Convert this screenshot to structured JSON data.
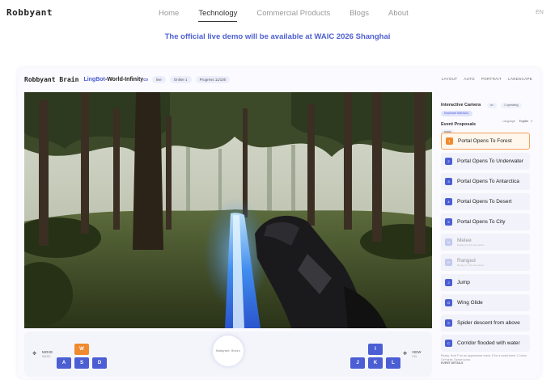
{
  "site": {
    "logo": "Robbyant",
    "nav": [
      {
        "label": "Home",
        "active": false
      },
      {
        "label": "Technology",
        "active": true
      },
      {
        "label": "Commercial Products",
        "active": false
      },
      {
        "label": "Blogs",
        "active": false
      },
      {
        "label": "About",
        "active": false
      }
    ],
    "lang": "EN",
    "banner": "The official live demo will be available at WAIC 2026 Shanghai"
  },
  "demo": {
    "brand": "Robbyant Brain",
    "model_prefix": "LingBot",
    "model_suffix": "-World-Infinity",
    "model_tag": "co",
    "pills": [
      "live",
      "Online 1",
      "Progress 11/100"
    ],
    "view_tabs": [
      "LANDSCAPE",
      "PORTRAIT",
      "AUTO",
      "LAYOUT"
    ]
  },
  "controls": {
    "move_label": "MOVE",
    "move_sub": "WASD",
    "view_label": "VIEW",
    "view_sub": "IJKL",
    "left_keys": {
      "up": "W",
      "left": "A",
      "down": "S",
      "right": "D"
    },
    "right_keys": {
      "up": "I",
      "left": "J",
      "down": "K",
      "right": "L"
    },
    "center_logo": "Robbyant Brain",
    "active_key": "W"
  },
  "side_panel": {
    "camera_title": "Interactive Camera",
    "camera_pills": [
      "on",
      "1 operating"
    ],
    "camera_mode": "Keyboard MANUAL",
    "events_title": "Event Proposals",
    "events_status": "ready",
    "language_label": "Language",
    "language_value": "English",
    "events": [
      {
        "num": "1",
        "label": "Portal Opens To Forest",
        "active": true,
        "dim": false
      },
      {
        "num": "2",
        "label": "Portal Opens To Underwater",
        "active": false,
        "dim": false
      },
      {
        "num": "3",
        "label": "Portal Opens To Antarctica",
        "active": false,
        "dim": false
      },
      {
        "num": "4",
        "label": "Portal Opens To Desert",
        "active": false,
        "dim": false
      },
      {
        "num": "5",
        "label": "Portal Opens To City",
        "active": false,
        "dim": false
      },
      {
        "num": "M",
        "label": "Melee",
        "hint": "Ready for 3rd-view action",
        "active": false,
        "dim": true
      },
      {
        "num": "R",
        "label": "Ranged",
        "hint": "Ready for 3rd-view action",
        "active": false,
        "dim": true
      },
      {
        "num": "J",
        "label": "Jump",
        "active": false,
        "dim": false
      },
      {
        "num": "G",
        "label": "Wing Glide",
        "active": false,
        "dim": false
      },
      {
        "num": "S",
        "label": "Spider descent from above",
        "active": false,
        "dim": false
      },
      {
        "num": "C",
        "label": "Corridor flooded with water",
        "active": false,
        "dim": false
      }
    ],
    "footer": "Ready. Hold F for an appearance event. E for a world event. C=view. Ctrl+grab. Space=jump.",
    "footer2": "EVENT DETAILS"
  },
  "colors": {
    "accent": "#4b5ed3",
    "highlight": "#f08a2e",
    "banner": "#4d5fd1"
  },
  "icons": {
    "move_arrow": "arrow-icon",
    "view_arrow": "arrow-icon"
  }
}
